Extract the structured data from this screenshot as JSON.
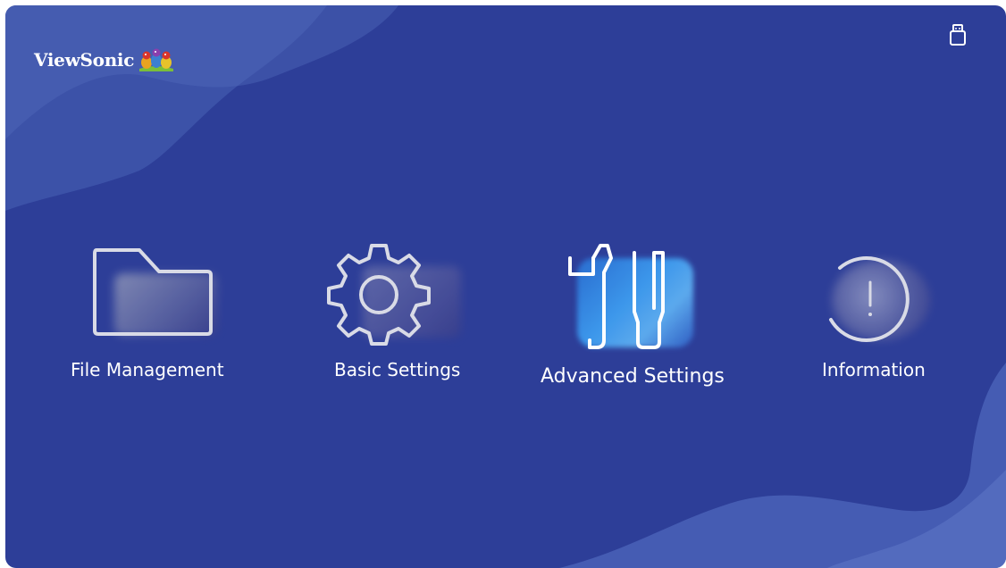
{
  "brand": {
    "name": "ViewSonic",
    "logo_icon": "three-birds-logo"
  },
  "status": {
    "usb_icon": "usb-drive-icon"
  },
  "menu": {
    "selected_index": 2,
    "items": [
      {
        "label": "File Management",
        "icon": "folder-icon"
      },
      {
        "label": "Basic Settings",
        "icon": "gear-icon"
      },
      {
        "label": "Advanced Settings",
        "icon": "tools-icon"
      },
      {
        "label": "Information",
        "icon": "info-icon"
      }
    ]
  },
  "colors": {
    "background": "#2d3e98",
    "wave": "#4e63b6",
    "highlight": "#2f8ee0",
    "icon_stroke": "#d9dbe6"
  }
}
